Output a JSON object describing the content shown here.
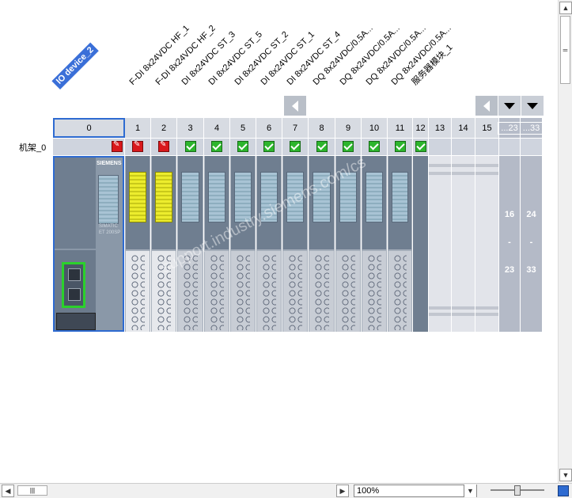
{
  "device": {
    "name": "IO device_2",
    "rack_label": "机架_0"
  },
  "module_labels": [
    "F-DI 8x24VDC HF_1",
    "F-DI 8x24VDC HF_2",
    "DI 8x24VDC ST_3",
    "DI 8x24VDC ST_5",
    "DI 8x24VDC ST_2",
    "DI 8x24VDC ST_1",
    "DI 8x24VDC ST_4",
    "DQ 8x24VDC/0.5A...",
    "DQ 8x24VDC/0.5A...",
    "DQ 8x24VDC/0.5A...",
    "DQ 8x24VDC/0.5A...",
    "服务器模块_1"
  ],
  "slots": [
    "0",
    "1",
    "2",
    "3",
    "4",
    "5",
    "6",
    "7",
    "8",
    "9",
    "10",
    "11",
    "12",
    "13",
    "14",
    "15",
    "...23",
    "...33"
  ],
  "status": [
    "err",
    "err",
    "err",
    "ok",
    "ok",
    "ok",
    "ok",
    "ok",
    "ok",
    "ok",
    "ok",
    "ok",
    "ok",
    "",
    "",
    "",
    "",
    ""
  ],
  "ranges": [
    {
      "from": "16",
      "dash": "-",
      "to": "23"
    },
    {
      "from": "24",
      "dash": "-",
      "to": "33"
    }
  ],
  "head_module": {
    "brand": "SIEMENS",
    "model": "SIMATIC",
    "type": "ET 200SP"
  },
  "watermark": "support.industry.siemens.com/cs",
  "zoom": {
    "value": "100%"
  }
}
